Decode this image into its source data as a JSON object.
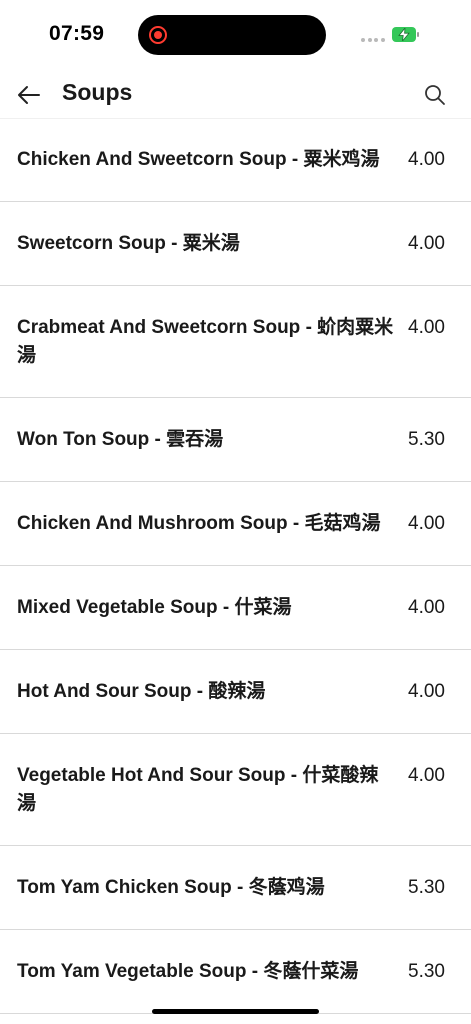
{
  "status_bar": {
    "time": "07:59",
    "battery_color": "#34c759",
    "record_color": "#ff3b30"
  },
  "header": {
    "title": "Soups",
    "back_icon": "arrow-left-icon",
    "search_icon": "search-icon"
  },
  "items": [
    {
      "name": "Chicken And Sweetcorn Soup - 粟米鸡湯",
      "price": "4.00"
    },
    {
      "name": "Sweetcorn Soup - 粟米湯",
      "price": "4.00"
    },
    {
      "name": "Crabmeat And Sweetcorn Soup - 蚧肉粟米湯",
      "price": "4.00"
    },
    {
      "name": "Won Ton Soup - 雲吞湯",
      "price": "5.30"
    },
    {
      "name": "Chicken And Mushroom Soup - 毛菇鸡湯",
      "price": "4.00"
    },
    {
      "name": "Mixed Vegetable Soup - 什菜湯",
      "price": "4.00"
    },
    {
      "name": "Hot And Sour Soup - 酸辣湯",
      "price": "4.00"
    },
    {
      "name": "Vegetable Hot And Sour Soup - 什菜酸辣湯",
      "price": "4.00"
    },
    {
      "name": "Tom Yam Chicken Soup - 冬蔭鸡湯",
      "price": "5.30"
    },
    {
      "name": "Tom Yam Vegetable Soup - 冬蔭什菜湯",
      "price": "5.30"
    }
  ]
}
